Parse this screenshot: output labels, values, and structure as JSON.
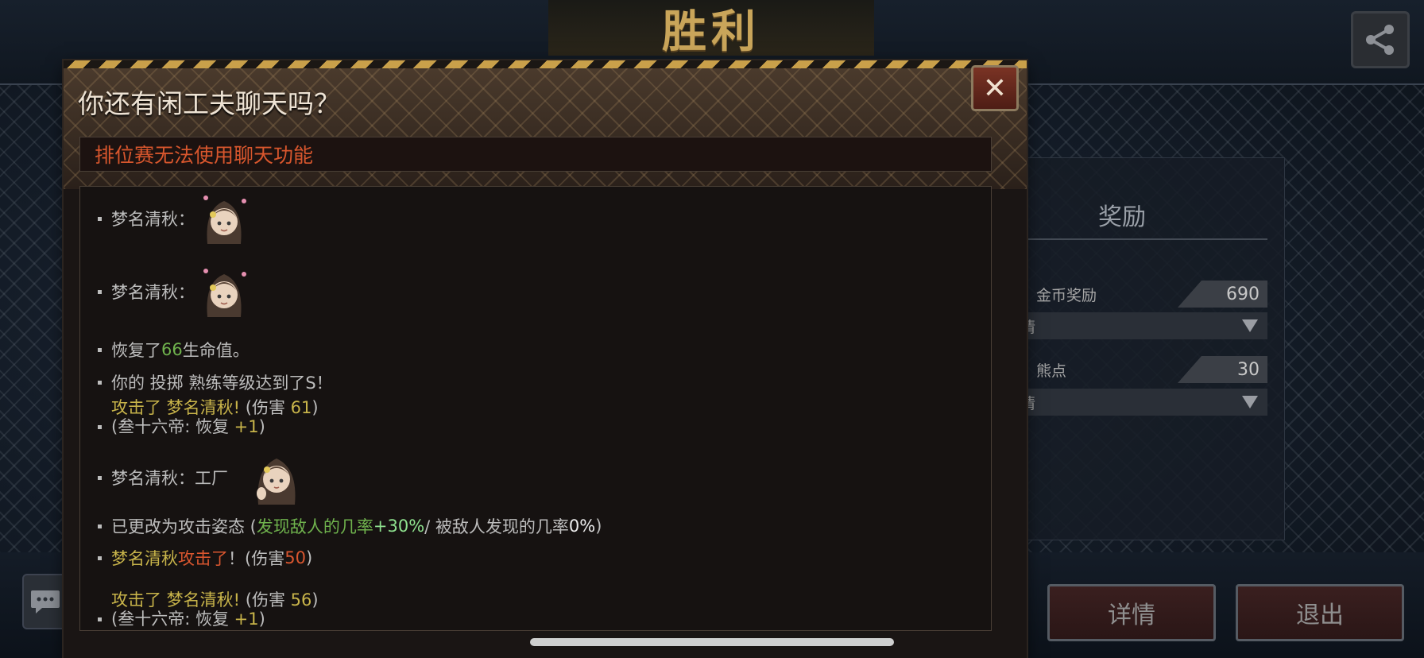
{
  "screen": {
    "victory_title": "胜利"
  },
  "dialog": {
    "title": "你还有闲工夫聊天吗？",
    "close_glyph": "✕",
    "notice": "排位赛无法使用聊天功能"
  },
  "chat_log": {
    "messages": [
      {
        "speaker": "梦名清秋：",
        "type": "sticker",
        "sticker": "girl-flower-sticker"
      },
      {
        "speaker": "梦名清秋：",
        "type": "sticker",
        "sticker": "girl-flower-sticker"
      },
      {
        "pre": "恢复了",
        "value": "66",
        "post": " 生命值。"
      },
      {
        "text": "你的 投掷 熟练等级达到了S！"
      },
      {
        "line1_a": "攻击了 梦名清秋!",
        "line1_b": " (伤害 ",
        "line1_val": "61",
        "line1_c": ")",
        "line2_a": "(叁十六帝: 恢复 ",
        "line2_val": "+1",
        "line2_c": ")"
      },
      {
        "speaker": "梦名清秋：工厂",
        "type": "sticker",
        "sticker": "girl-wave-sticker"
      },
      {
        "a": "已更改为攻击姿态 (",
        "b": "发现敌人的几率 ",
        "c": "+30%",
        "d": " / 被敌人发现的几率 ",
        "e": "0%",
        "f": ")"
      },
      {
        "a": "梦名清秋  ",
        "b": "攻击了",
        "c": "！(伤害 ",
        "d": "50",
        "e": ")"
      },
      {
        "line1_a": "攻击了 梦名清秋!",
        "line1_b": " (伤害 ",
        "line1_val": "56",
        "line1_c": ")",
        "line2_a": "(叁十六帝: 恢复 ",
        "line2_val": "+1",
        "line2_c": ")"
      }
    ]
  },
  "rewards": {
    "title": "奖励",
    "items": [
      {
        "icon": "coin-icon",
        "label": "金币奖励",
        "value": "690",
        "detail": "详情"
      },
      {
        "icon": "bear-point-icon",
        "label": "熊点",
        "value": "30",
        "detail": "详情"
      }
    ]
  },
  "buttons": {
    "details": "详情",
    "exit": "退出"
  },
  "colors": {
    "accent_gold": "#c9a55a",
    "notice_red": "#d7562d",
    "value_green": "#6fb24d",
    "name_yellow": "#c8b44a"
  }
}
